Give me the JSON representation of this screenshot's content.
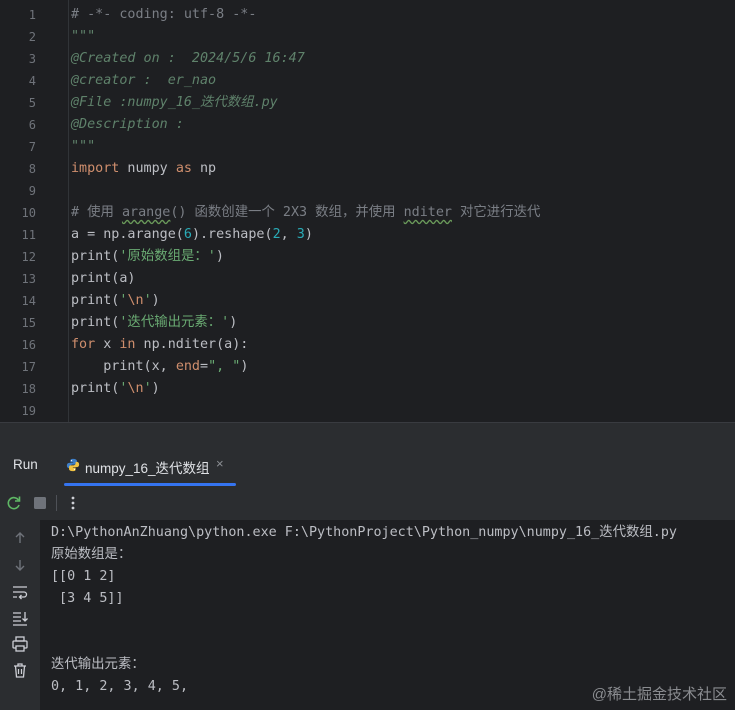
{
  "editor": {
    "line_numbers": [
      "1",
      "2",
      "3",
      "4",
      "5",
      "6",
      "7",
      "8",
      "9",
      "10",
      "11",
      "12",
      "13",
      "14",
      "15",
      "16",
      "17",
      "18",
      "19"
    ],
    "lines": [
      [
        {
          "t": "# -*- coding: utf-8 -*-",
          "c": "cmt"
        }
      ],
      [
        {
          "t": "\"\"\"",
          "c": "doc"
        }
      ],
      [
        {
          "t": "@Created on :  2024/5/6 16:47",
          "c": "doc"
        }
      ],
      [
        {
          "t": "@creator :  er_nao",
          "c": "doc"
        }
      ],
      [
        {
          "t": "@File :numpy_16_迭代数组.py",
          "c": "doc"
        }
      ],
      [
        {
          "t": "@Description :",
          "c": "doc"
        }
      ],
      [
        {
          "t": "\"\"\"",
          "c": "doc"
        }
      ],
      [
        {
          "t": "import",
          "c": "kw"
        },
        {
          "t": " numpy ",
          "c": ""
        },
        {
          "t": "as",
          "c": "kw"
        },
        {
          "t": " np",
          "c": ""
        }
      ],
      [],
      [
        {
          "t": "# 使用 ",
          "c": "cmt"
        },
        {
          "t": "arange",
          "c": "cmt uline"
        },
        {
          "t": "() 函数创建一个 2X3 数组，并使用 ",
          "c": "cmt"
        },
        {
          "t": "nditer",
          "c": "cmt uline"
        },
        {
          "t": " 对它进行迭代",
          "c": "cmt"
        }
      ],
      [
        {
          "t": "a = np.arange(",
          "c": ""
        },
        {
          "t": "6",
          "c": "num"
        },
        {
          "t": ").reshape(",
          "c": ""
        },
        {
          "t": "2",
          "c": "num"
        },
        {
          "t": ", ",
          "c": ""
        },
        {
          "t": "3",
          "c": "num"
        },
        {
          "t": ")",
          "c": ""
        }
      ],
      [
        {
          "t": "print(",
          "c": ""
        },
        {
          "t": "'原始数组是：'",
          "c": "str"
        },
        {
          "t": ")",
          "c": ""
        }
      ],
      [
        {
          "t": "print(a)",
          "c": ""
        }
      ],
      [
        {
          "t": "print(",
          "c": ""
        },
        {
          "t": "'",
          "c": "str"
        },
        {
          "t": "\\n",
          "c": "esc"
        },
        {
          "t": "'",
          "c": "str"
        },
        {
          "t": ")",
          "c": ""
        }
      ],
      [
        {
          "t": "print(",
          "c": ""
        },
        {
          "t": "'迭代输出元素：'",
          "c": "str"
        },
        {
          "t": ")",
          "c": ""
        }
      ],
      [
        {
          "t": "for",
          "c": "kw"
        },
        {
          "t": " x ",
          "c": ""
        },
        {
          "t": "in",
          "c": "kw"
        },
        {
          "t": " np.nditer(a):",
          "c": ""
        }
      ],
      [
        {
          "t": "    print(x, ",
          "c": ""
        },
        {
          "t": "end",
          "c": "kw"
        },
        {
          "t": "=",
          "c": ""
        },
        {
          "t": "\", \"",
          "c": "str"
        },
        {
          "t": ")",
          "c": ""
        }
      ],
      [
        {
          "t": "print(",
          "c": ""
        },
        {
          "t": "'",
          "c": "str"
        },
        {
          "t": "\\n",
          "c": "esc"
        },
        {
          "t": "'",
          "c": "str"
        },
        {
          "t": ")",
          "c": ""
        }
      ],
      []
    ]
  },
  "run_panel": {
    "label": "Run",
    "tab_title": "numpy_16_迭代数组",
    "tab_close": "×"
  },
  "console": {
    "lines": [
      "D:\\PythonAnZhuang\\python.exe F:\\PythonProject\\Python_numpy\\numpy_16_迭代数组.py",
      "原始数组是：",
      "[[0 1 2]",
      " [3 4 5]]",
      "",
      "",
      "迭代输出元素：",
      "0, 1, 2, 3, 4, 5,"
    ]
  },
  "watermark": "@稀土掘金技术社区",
  "colors": {
    "editor_bg": "#1e1f22",
    "panel_bg": "#2b2d30",
    "accent": "#3574f0",
    "keyword": "#cf8e6d",
    "string": "#6aab73",
    "number": "#2aacb8",
    "comment": "#7a7e85",
    "docstring": "#5f826b"
  },
  "icons": [
    "python-file-icon",
    "rerun-icon",
    "stop-icon",
    "more-options-icon",
    "scroll-up-icon",
    "scroll-down-icon",
    "soft-wrap-icon",
    "scroll-to-end-icon",
    "print-icon",
    "trash-icon"
  ]
}
